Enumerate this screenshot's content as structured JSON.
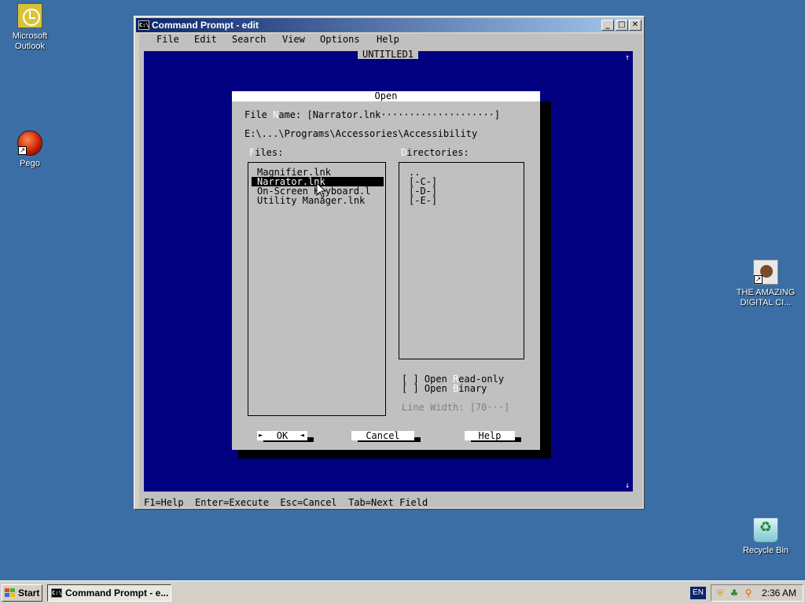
{
  "desktop": {
    "icons": [
      {
        "label_line1": "Microsoft",
        "label_line2": "Outlook"
      },
      {
        "label_line1": "Pego",
        "label_line2": ""
      },
      {
        "label_line1": "THE AMAZING",
        "label_line2": "DIGITAL CI..."
      },
      {
        "label_line1": "Recycle Bin",
        "label_line2": ""
      }
    ]
  },
  "window": {
    "title": "Command Prompt - edit",
    "icon_text": "C:\\",
    "buttons": {
      "minimize": "_",
      "maximize": "□",
      "close": "✕"
    }
  },
  "editor": {
    "menu": [
      "File",
      "Edit",
      "Search",
      "View",
      "Options",
      "Help"
    ],
    "document_title": "UNTITLED1",
    "status": "F1=Help  Enter=Execute  Esc=Cancel  Tab=Next Field"
  },
  "dialog": {
    "title": "Open",
    "file_name_prefix": "File ",
    "file_name_hotkey": "N",
    "file_name_suffix": "ame: [Narrator.lnk····················]",
    "path": "E:\\...\\Programs\\Accessories\\Accessibility",
    "files_hotkey": "F",
    "files_label_rest": "iles:",
    "dirs_hotkey": "D",
    "dirs_label_rest": "irectories:",
    "files": [
      "Magnifier.lnk",
      "Narrator.lnk",
      "On-Screen Keyboard.l",
      "Utility Manager.lnk"
    ],
    "selected_file_index": 1,
    "directories": [
      "..",
      "[-C-]",
      "[-D-]",
      "[-E-]"
    ],
    "read_only_box": "[ ] Open ",
    "read_only_hotkey": "R",
    "read_only_rest": "ead-only",
    "binary_box": "[ ] Open ",
    "binary_hotkey": "B",
    "binary_rest": "inary",
    "line_width": "Line Width: [70···]",
    "ok_label": "OK",
    "ok_left_marker": "►",
    "ok_right_marker": "◄",
    "cancel_label": "Cancel",
    "help_label": "Help"
  },
  "taskbar": {
    "start_label": "Start",
    "task_label": "Command Prompt - e...",
    "language": "EN",
    "clock": "2:36 AM"
  },
  "colors": {
    "desktop": "#3a6ea5",
    "editor_background": "#000080",
    "dialog_background": "#c0c0c0",
    "titlebar_active": "#0a246a"
  }
}
